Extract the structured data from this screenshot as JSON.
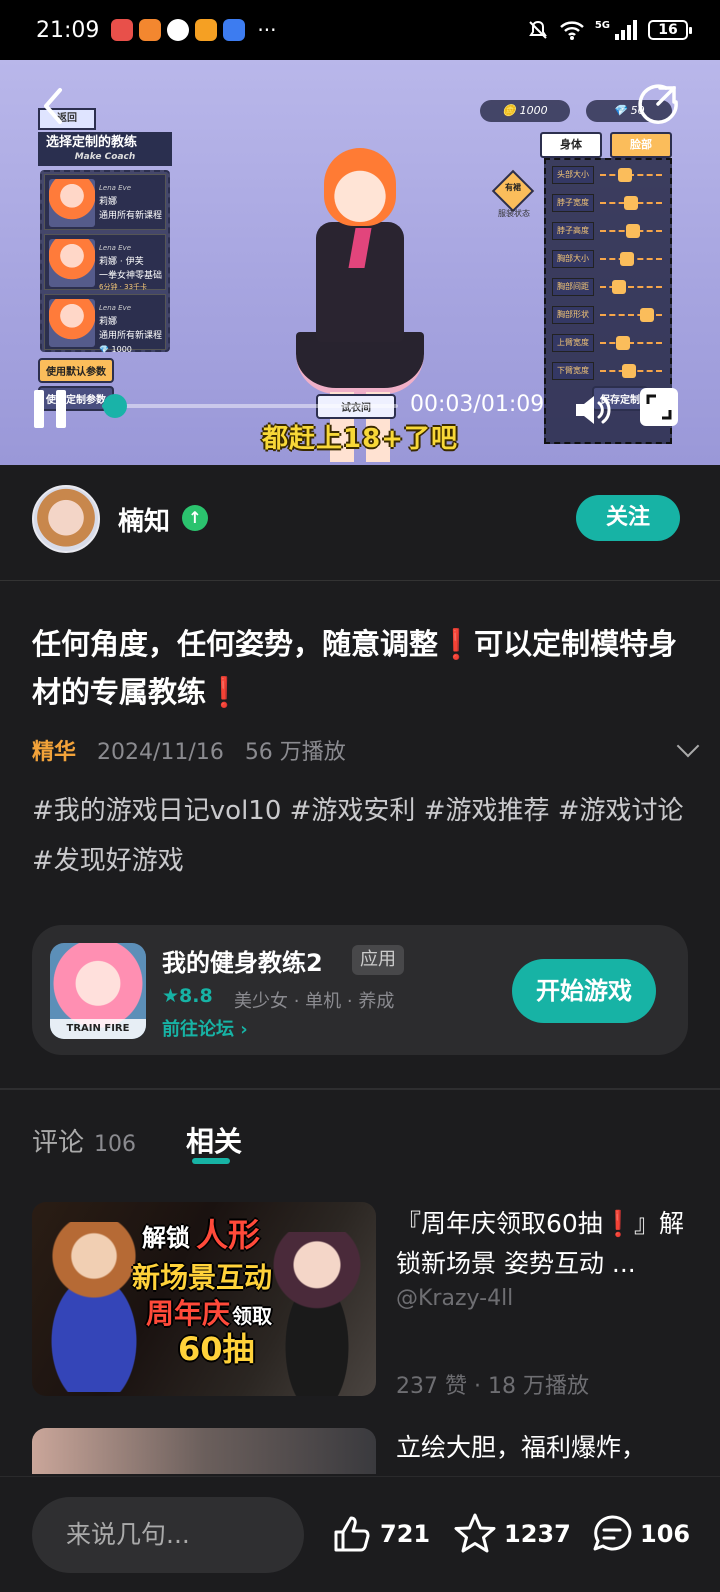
{
  "status_bar": {
    "time": "21:09",
    "dots": "···",
    "network": "5G",
    "battery": "16"
  },
  "video": {
    "back_label": "返回",
    "coins": "1000",
    "gems": "50",
    "coach_title": "选择定制的教练",
    "coach_subtitle": "Make Coach",
    "coaches": [
      {
        "name": "莉娜",
        "desc": "通用所有新课程",
        "tag": "Lena Eve"
      },
      {
        "name": "莉娜 · 伊芙",
        "desc": "一拳女神零基础",
        "extra": "6分钟 · 33千卡",
        "tag": "Lena Eve"
      },
      {
        "name": "莉娜",
        "desc": "通用所有新课程",
        "price": "1000",
        "tag": "Lena Eve"
      }
    ],
    "default_params_btn": "使用默认参数",
    "custom_save_btn": "使用定制参数",
    "tab_body": "身体",
    "tab_face": "脸部",
    "tag_top": "有裙",
    "tag_top_sub": "服装状态",
    "sliders": [
      "头部大小",
      "脖子宽度",
      "脖子高度",
      "胸部大小",
      "胸部间距",
      "胸部形状",
      "上臂宽度",
      "下臂宽度"
    ],
    "save_custom": "保存定制",
    "time_btn": "试衣间",
    "subtitle": "都赶上18+了吧",
    "current_time": "00:03",
    "total_time": "01:09",
    "progress": 0.043,
    "accent": "#19b3a8"
  },
  "author": {
    "name": "楠知",
    "follow_label": "关注"
  },
  "post": {
    "title": "任何角度，任何姿势，随意调整❗可以定制模特身材的专属教练❗",
    "badge": "精华",
    "date": "2024/11/16",
    "plays": "56 万播放",
    "tags": "#我的游戏日记vol10 #游戏安利 #游戏推荐 #游戏讨论 #发现好游戏"
  },
  "game": {
    "name": "我的健身教练2",
    "type_tag": "应用",
    "rating": "★8.8",
    "categories": "美少女 · 单机 · 养成",
    "forum_link": "前往论坛 ›",
    "start_label": "开始游戏",
    "icon_band": "TRAIN FIRE"
  },
  "tabs": {
    "comment_label": "评论",
    "comment_count": "106",
    "related_label": "相关"
  },
  "related": [
    {
      "title": "『周年庆领取60抽❗』解锁新场景 姿势互动 ...",
      "author": "@Krazy-4ll",
      "stats": "237 赞 · 18 万播放",
      "thumb_text": [
        "解锁",
        "人形",
        "新场景互动",
        "周年庆",
        "领取",
        "60抽"
      ]
    },
    {
      "title": "立绘大胆，福利爆炸，"
    }
  ],
  "bottom": {
    "comment_placeholder": "来说几句...",
    "likes": "721",
    "favorites": "1237",
    "comments": "106"
  }
}
